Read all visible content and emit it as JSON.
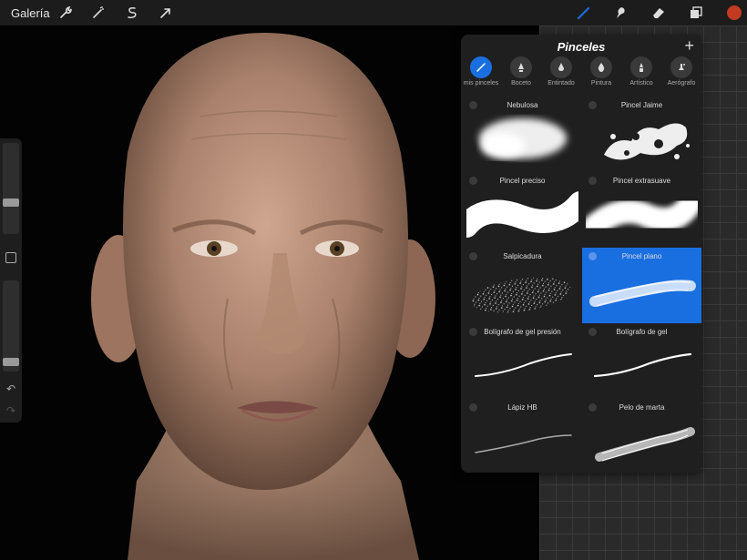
{
  "topbar": {
    "gallery_label": "Galería",
    "left_icons": [
      "wrench-icon",
      "magic-wand-icon",
      "selection-icon",
      "transform-arrow-icon"
    ],
    "right_icons": [
      "brush-icon",
      "smudge-icon",
      "eraser-icon",
      "layers-icon",
      "color-swatch"
    ],
    "active_color": "#c23a22",
    "accent": "#1a6fe0"
  },
  "sidebar": {
    "size_level": 0.62,
    "opacity_level": 0.9,
    "icons": [
      "modify-square-icon",
      "undo-icon",
      "redo-icon"
    ]
  },
  "panel": {
    "title": "Pinceles",
    "add_icon": "plus-icon",
    "categories": [
      {
        "label": "mis pinceles",
        "icon": "brush-icon"
      },
      {
        "label": "Boceto",
        "icon": "pencil-nib-icon"
      },
      {
        "label": "Entintado",
        "icon": "ink-drop-icon"
      },
      {
        "label": "Pintura",
        "icon": "paint-drop-icon"
      },
      {
        "label": "Artístico",
        "icon": "art-nib-icon"
      },
      {
        "label": "Aerógrafo",
        "icon": "airbrush-icon"
      }
    ],
    "brushes": [
      {
        "name": "Nebulosa",
        "selected": false
      },
      {
        "name": "Pincel Jaime",
        "selected": false
      },
      {
        "name": "Pincel preciso",
        "selected": false
      },
      {
        "name": "Pincel extrasuave",
        "selected": false
      },
      {
        "name": "Salpicadura",
        "selected": false
      },
      {
        "name": "Pincel plano",
        "selected": true
      },
      {
        "name": "Bolígrafo de gel presión",
        "selected": false
      },
      {
        "name": "Bolígrafo de gel",
        "selected": false
      },
      {
        "name": "Lápiz HB",
        "selected": false
      },
      {
        "name": "Pelo de marta",
        "selected": false
      }
    ]
  }
}
